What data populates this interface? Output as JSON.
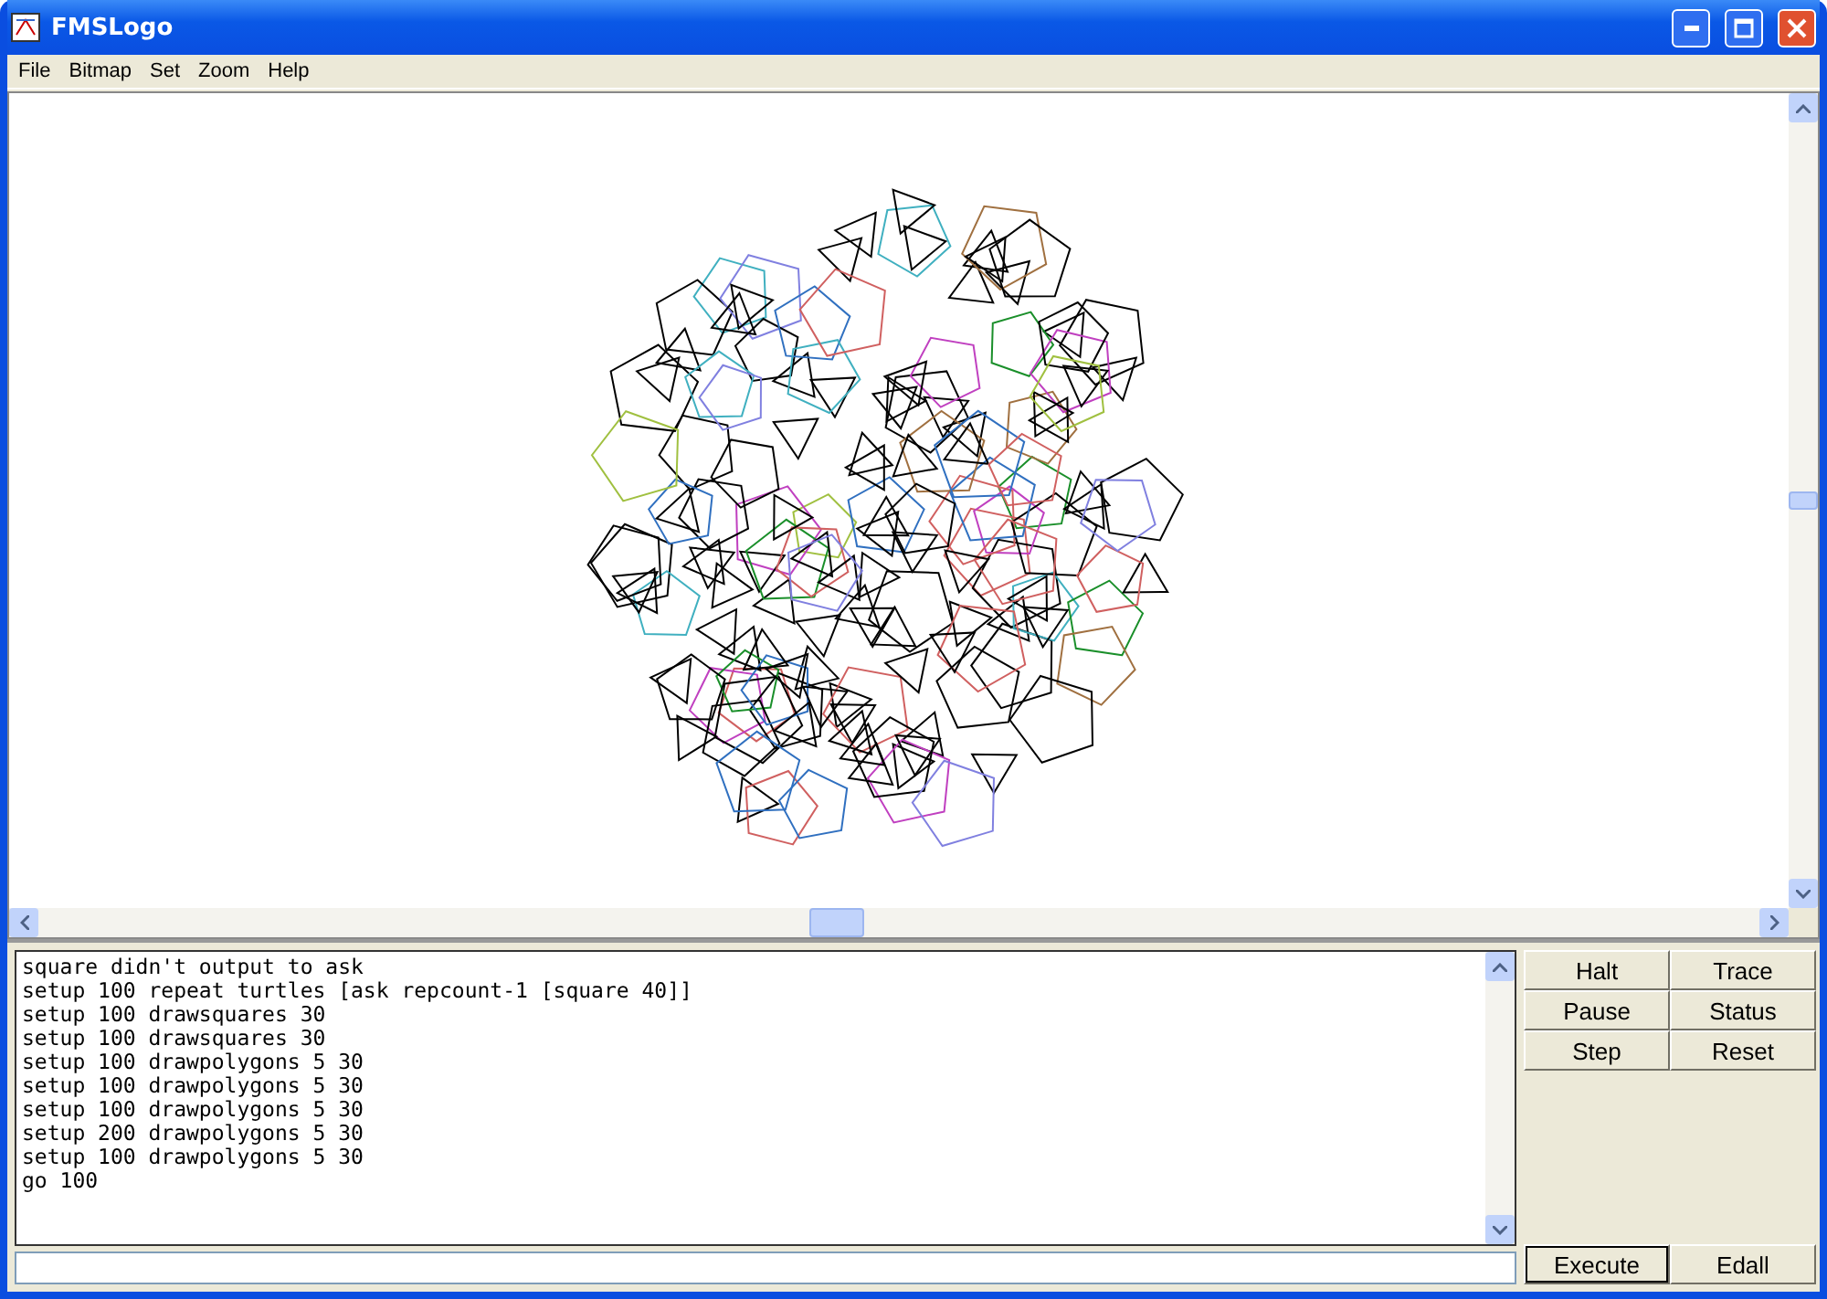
{
  "window": {
    "title": "FMSLogo"
  },
  "menu": [
    "File",
    "Bitmap",
    "Set",
    "Zoom",
    "Help"
  ],
  "console": {
    "lines": [
      "square didn't output to ask",
      "setup 100 repeat turtles [ask repcount-1 [square 40]]",
      "setup 100 drawsquares 30",
      "setup 100 drawsquares 30",
      "setup 100 drawpolygons 5 30",
      "setup 100 drawpolygons 5 30",
      "setup 100 drawpolygons 5 30",
      "setup 200 drawpolygons 5 30",
      "setup 100 drawpolygons 5 30",
      "go 100"
    ]
  },
  "buttons": [
    {
      "label": "Halt"
    },
    {
      "label": "Trace"
    },
    {
      "label": "Pause"
    },
    {
      "label": "Status"
    },
    {
      "label": "Step"
    },
    {
      "label": "Reset"
    }
  ],
  "bottom_buttons": [
    {
      "label": "Execute",
      "selected": true
    },
    {
      "label": "Edall",
      "selected": false
    }
  ]
}
